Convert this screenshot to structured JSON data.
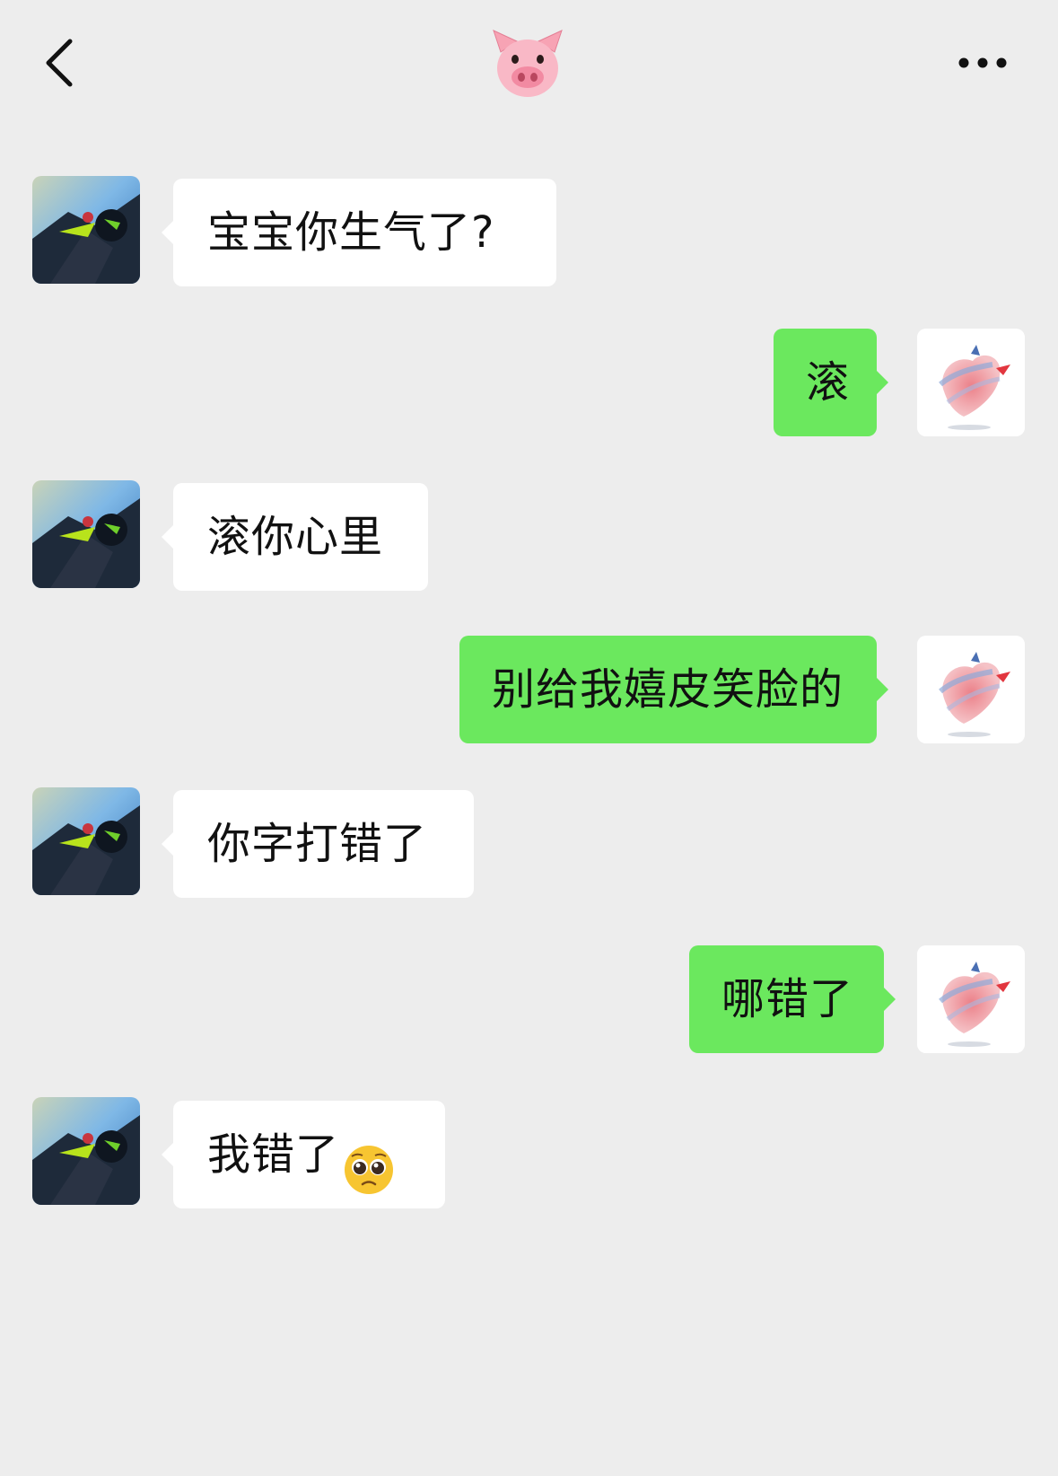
{
  "header": {
    "title_icon": "pig-face-icon",
    "back_icon": "chevron-left-icon",
    "more_icon": "more-dots-icon"
  },
  "colors": {
    "background": "#ededed",
    "incoming_bubble": "#ffffff",
    "outgoing_bubble": "#6be85e"
  },
  "messages": [
    {
      "side": "in",
      "text": "宝宝你生气了?"
    },
    {
      "side": "out",
      "text": "滚"
    },
    {
      "side": "in",
      "text": "滚你心里"
    },
    {
      "side": "out",
      "text": "别给我嬉皮笑脸的"
    },
    {
      "side": "in",
      "text": "你字打错了"
    },
    {
      "side": "out",
      "text": "哪错了"
    },
    {
      "side": "in",
      "text": "我错了",
      "emoji": "pleading-face-icon"
    }
  ]
}
